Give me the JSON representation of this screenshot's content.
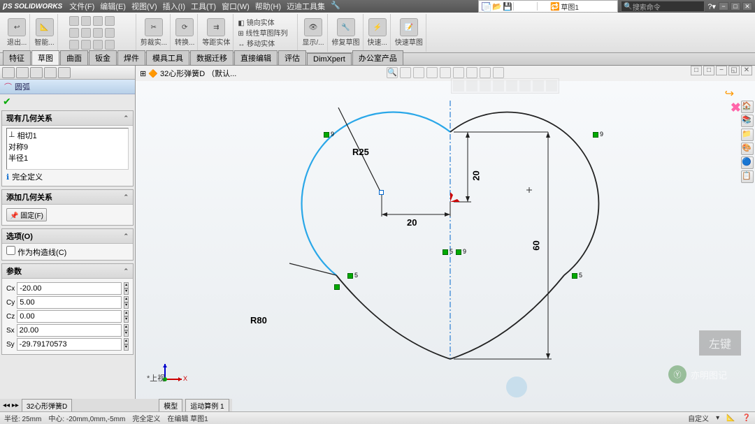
{
  "app": {
    "name": "SOLIDWORKS"
  },
  "menu": [
    "文件(F)",
    "编辑(E)",
    "视图(V)",
    "插入(I)",
    "工具(T)",
    "窗口(W)",
    "帮助(H)",
    "迈迪工具集"
  ],
  "qat_label": "草图1",
  "search_placeholder": "搜索命令",
  "ribbon_groups": [
    "退出...",
    "智能...",
    "剪裁实...",
    "转换...",
    "等距实体",
    "镜向实体",
    "线性草图阵列",
    "移动实体",
    "显示/...",
    "修复草图",
    "快速...",
    "快速草图"
  ],
  "tabs": [
    "特征",
    "草图",
    "曲面",
    "钣金",
    "焊件",
    "模具工具",
    "数据迁移",
    "直接编辑",
    "评估",
    "DimXpert",
    "办公室产品"
  ],
  "active_tab": 1,
  "tree": {
    "doc": "32心形弹簧D",
    "note": "（默认..."
  },
  "panel": {
    "title": "圆弧"
  },
  "sections": {
    "existing": {
      "title": "现有几何关系",
      "items": [
        "相切1",
        "对称9",
        "半径1"
      ],
      "status_icon": "ℹ",
      "status": "完全定义"
    },
    "add": {
      "title": "添加几何关系",
      "fixed": "固定(F)"
    },
    "options": {
      "title": "选项(O)",
      "construction": "作为构造线(C)"
    },
    "params": {
      "title": "参数",
      "values": [
        "-20.00",
        "5.00",
        "0.00",
        "20.00",
        "-29.79170573"
      ]
    }
  },
  "dimensions": {
    "r25": "R25",
    "r80": "R80",
    "d20h": "20",
    "d20v": "20",
    "d60": "60"
  },
  "triad": {
    "x": "X"
  },
  "view_label": "*上视",
  "bottom_tabs": [
    "32心形弹簧D",
    "模型",
    "运动算例 1"
  ],
  "status_bar": {
    "radius": "半径: 25mm",
    "center": "中心: -20mm,0mm,-5mm",
    "def": "完全定义",
    "edit": "在编辑 草图1",
    "custom": "自定义"
  },
  "leftkey": "左键",
  "watermark": "亦明图记",
  "hint5": "5",
  "hint9": "9"
}
